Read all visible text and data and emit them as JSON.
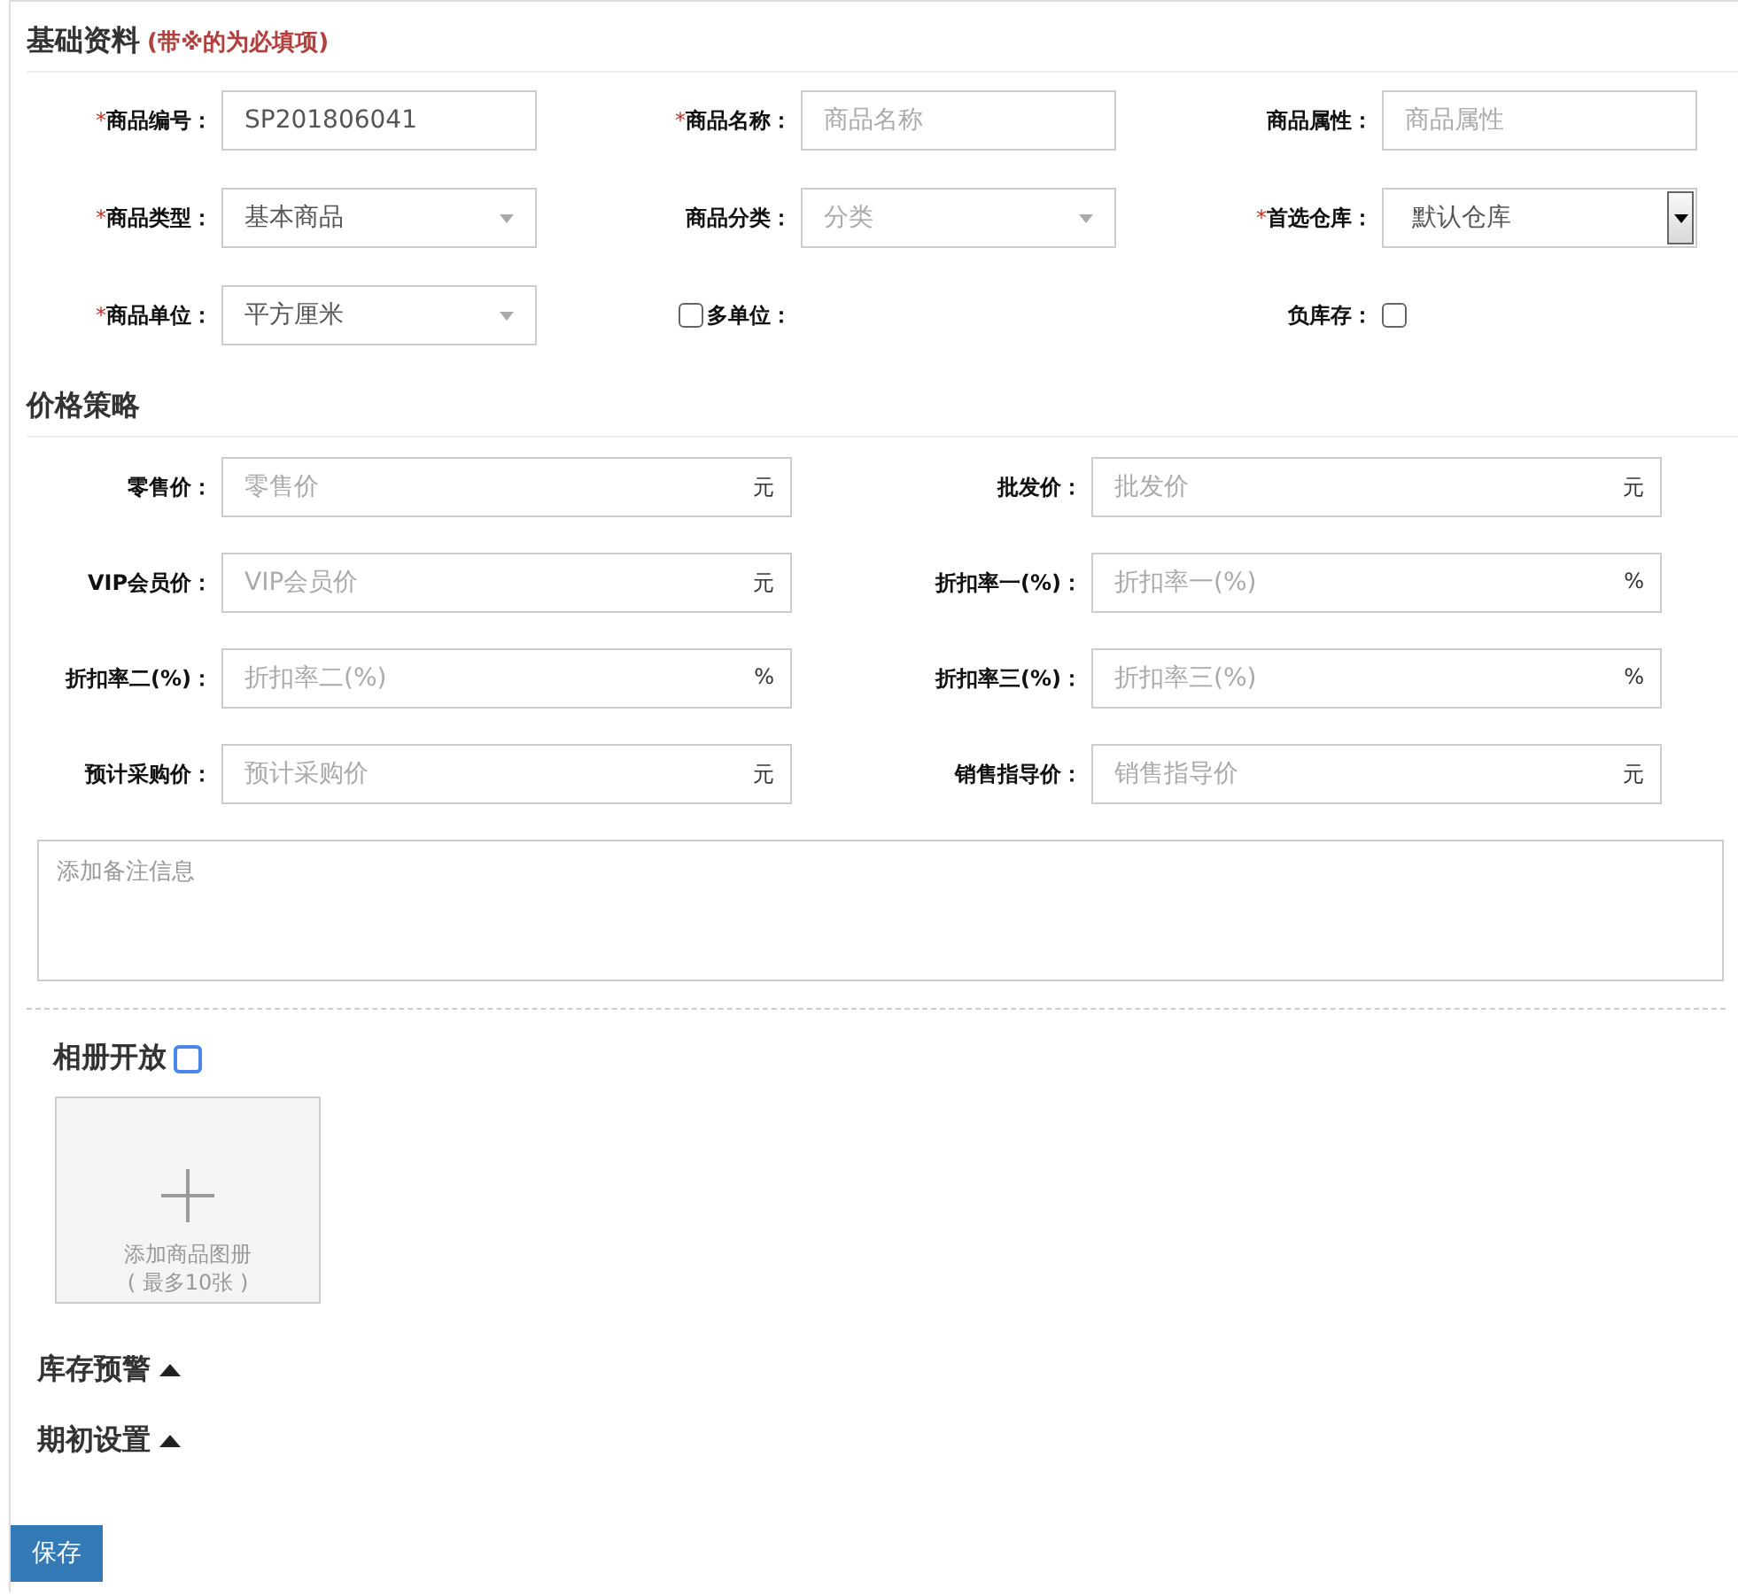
{
  "basic": {
    "title": "基础资料",
    "note": "(带※的为必填项)",
    "rows": [
      [
        {
          "kind": "text",
          "required_mark": "*",
          "label": "商品编号：",
          "value": "SP201806041"
        },
        {
          "kind": "text",
          "required_mark": "*",
          "label": "商品名称：",
          "placeholder": "商品名称"
        },
        {
          "kind": "text",
          "label": "商品属性：",
          "placeholder": "商品属性"
        }
      ],
      [
        {
          "kind": "select",
          "required_mark": "*",
          "label": "商品类型：",
          "value": "基本商品"
        },
        {
          "kind": "select",
          "label": "商品分类：",
          "placeholder": "分类"
        },
        {
          "kind": "native_select",
          "required_mark": "*",
          "label": "首选仓库：",
          "value": "默认仓库"
        }
      ],
      [
        {
          "kind": "select",
          "required_mark": "*",
          "label": "商品单位：",
          "value": "平方厘米"
        },
        {
          "kind": "checkbox_before",
          "label": "多单位：",
          "checked": false
        },
        {
          "kind": "checkbox_after",
          "label": "负库存：",
          "checked": false
        }
      ]
    ]
  },
  "pricing": {
    "title": "价格策略",
    "fields": [
      {
        "label": "零售价：",
        "placeholder": "零售价",
        "unit": "元"
      },
      {
        "label": "批发价：",
        "placeholder": "批发价",
        "unit": "元"
      },
      {
        "label": "VIP会员价：",
        "placeholder": "VIP会员价",
        "unit": "元"
      },
      {
        "label": "折扣率一(%)：",
        "placeholder": "折扣率一(%)",
        "unit": "%"
      },
      {
        "label": "折扣率二(%)：",
        "placeholder": "折扣率二(%)",
        "unit": "%"
      },
      {
        "label": "折扣率三(%)：",
        "placeholder": "折扣率三(%)",
        "unit": "%"
      },
      {
        "label": "预计采购价：",
        "placeholder": "预计采购价",
        "unit": "元"
      },
      {
        "label": "销售指导价：",
        "placeholder": "销售指导价",
        "unit": "元"
      }
    ],
    "remarks": {
      "placeholder": "添加备注信息"
    }
  },
  "album": {
    "label": "相册开放",
    "checked": false,
    "upload_text": "添加商品图册",
    "upload_hint": "( 最多10张 )"
  },
  "collapsibles": [
    {
      "title": "库存预警"
    },
    {
      "title": "期初设置"
    }
  ],
  "save_button": "保存"
}
